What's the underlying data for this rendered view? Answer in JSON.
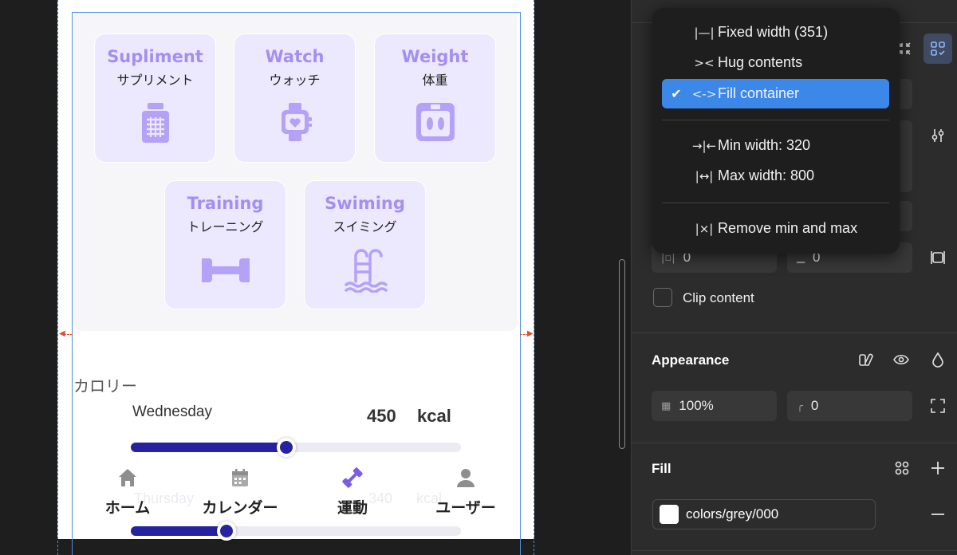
{
  "categories": [
    {
      "en": "Supliment",
      "jp": "サプリメント",
      "icon": "supplement-bottle-icon"
    },
    {
      "en": "Watch",
      "jp": "ウォッチ",
      "icon": "smartwatch-icon"
    },
    {
      "en": "Weight",
      "jp": "体重",
      "icon": "scale-icon"
    },
    {
      "en": "Training",
      "jp": "トレーニング",
      "icon": "dumbbell-icon"
    },
    {
      "en": "Swiming",
      "jp": "スイミング",
      "icon": "pool-ladder-icon"
    }
  ],
  "calorie": {
    "title": "カロリー",
    "day": "Wednesday",
    "value": "450",
    "unit": "kcal",
    "progress": 0.47,
    "progress2": 0.29,
    "ghost_day": "Thursday",
    "ghost_value": "340",
    "ghost_unit": "kcal"
  },
  "bottom_nav": [
    {
      "label": "ホーム",
      "icon": "home-icon"
    },
    {
      "label": "カレンダー",
      "icon": "calendar-icon"
    },
    {
      "label": "運動",
      "icon": "dumbbell-icon"
    },
    {
      "label": "ユーザー",
      "icon": "user-icon"
    }
  ],
  "colors": {
    "accent_purple": "#a48ff0",
    "card_bg": "#ece8fe",
    "slider_fill": "#2623a0",
    "menu_highlight": "#3b88e8"
  },
  "menu": {
    "items": [
      {
        "icon": "|—|",
        "label": "Fixed width (351)",
        "selected": false
      },
      {
        "icon": "><",
        "label": "Hug contents",
        "selected": false
      },
      {
        "icon": "<->",
        "label": "Fill container",
        "selected": true
      }
    ],
    "constraints": [
      {
        "icon": "→|←",
        "label": "Min width: 320"
      },
      {
        "icon": "|↔|",
        "label": "Max width: 800"
      }
    ],
    "remove": {
      "icon": "|×|",
      "label": "Remove min and max"
    }
  },
  "panel": {
    "padding_left_value": "0",
    "padding_bottom_value": "0",
    "clip_content_label": "Clip content",
    "appearance": {
      "title": "Appearance",
      "opacity": "100%",
      "radius": "0"
    },
    "fill": {
      "title": "Fill",
      "swatch_name": "colors/grey/000",
      "swatch_color": "#ffffff"
    }
  }
}
